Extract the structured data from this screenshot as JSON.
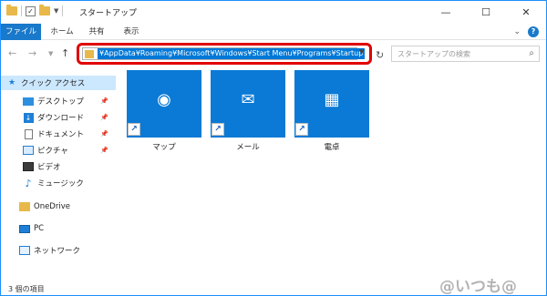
{
  "window": {
    "title": "スタートアップ",
    "controls": {
      "minimize": "—",
      "maximize": "☐",
      "close": "✕"
    }
  },
  "ribbon": {
    "tabs": [
      "ファイル",
      "ホーム",
      "共有",
      "表示"
    ]
  },
  "navigation": {
    "address_path": "¥AppData¥Roaming¥Microsoft¥Windows¥Start Menu¥Programs¥Startup",
    "search_placeholder": "スタートアップの検索"
  },
  "sidebar": {
    "quick_access": "クイック アクセス",
    "items": [
      {
        "label": "デスクトップ",
        "pinned": true,
        "icon": "desktop-icon"
      },
      {
        "label": "ダウンロード",
        "pinned": true,
        "icon": "download-icon"
      },
      {
        "label": "ドキュメント",
        "pinned": true,
        "icon": "document-icon"
      },
      {
        "label": "ピクチャ",
        "pinned": true,
        "icon": "picture-icon"
      },
      {
        "label": "ビデオ",
        "pinned": false,
        "icon": "video-icon"
      },
      {
        "label": "ミュージック",
        "pinned": false,
        "icon": "music-icon"
      }
    ],
    "onedrive": "OneDrive",
    "pc": "PC",
    "network": "ネットワーク"
  },
  "files": [
    {
      "name": "マップ",
      "icon": "map-pin-icon"
    },
    {
      "name": "メール",
      "icon": "mail-icon"
    },
    {
      "name": "電卓",
      "icon": "calculator-icon"
    }
  ],
  "status": {
    "item_count": "3 個の項目"
  },
  "watermark": "@いつも@"
}
